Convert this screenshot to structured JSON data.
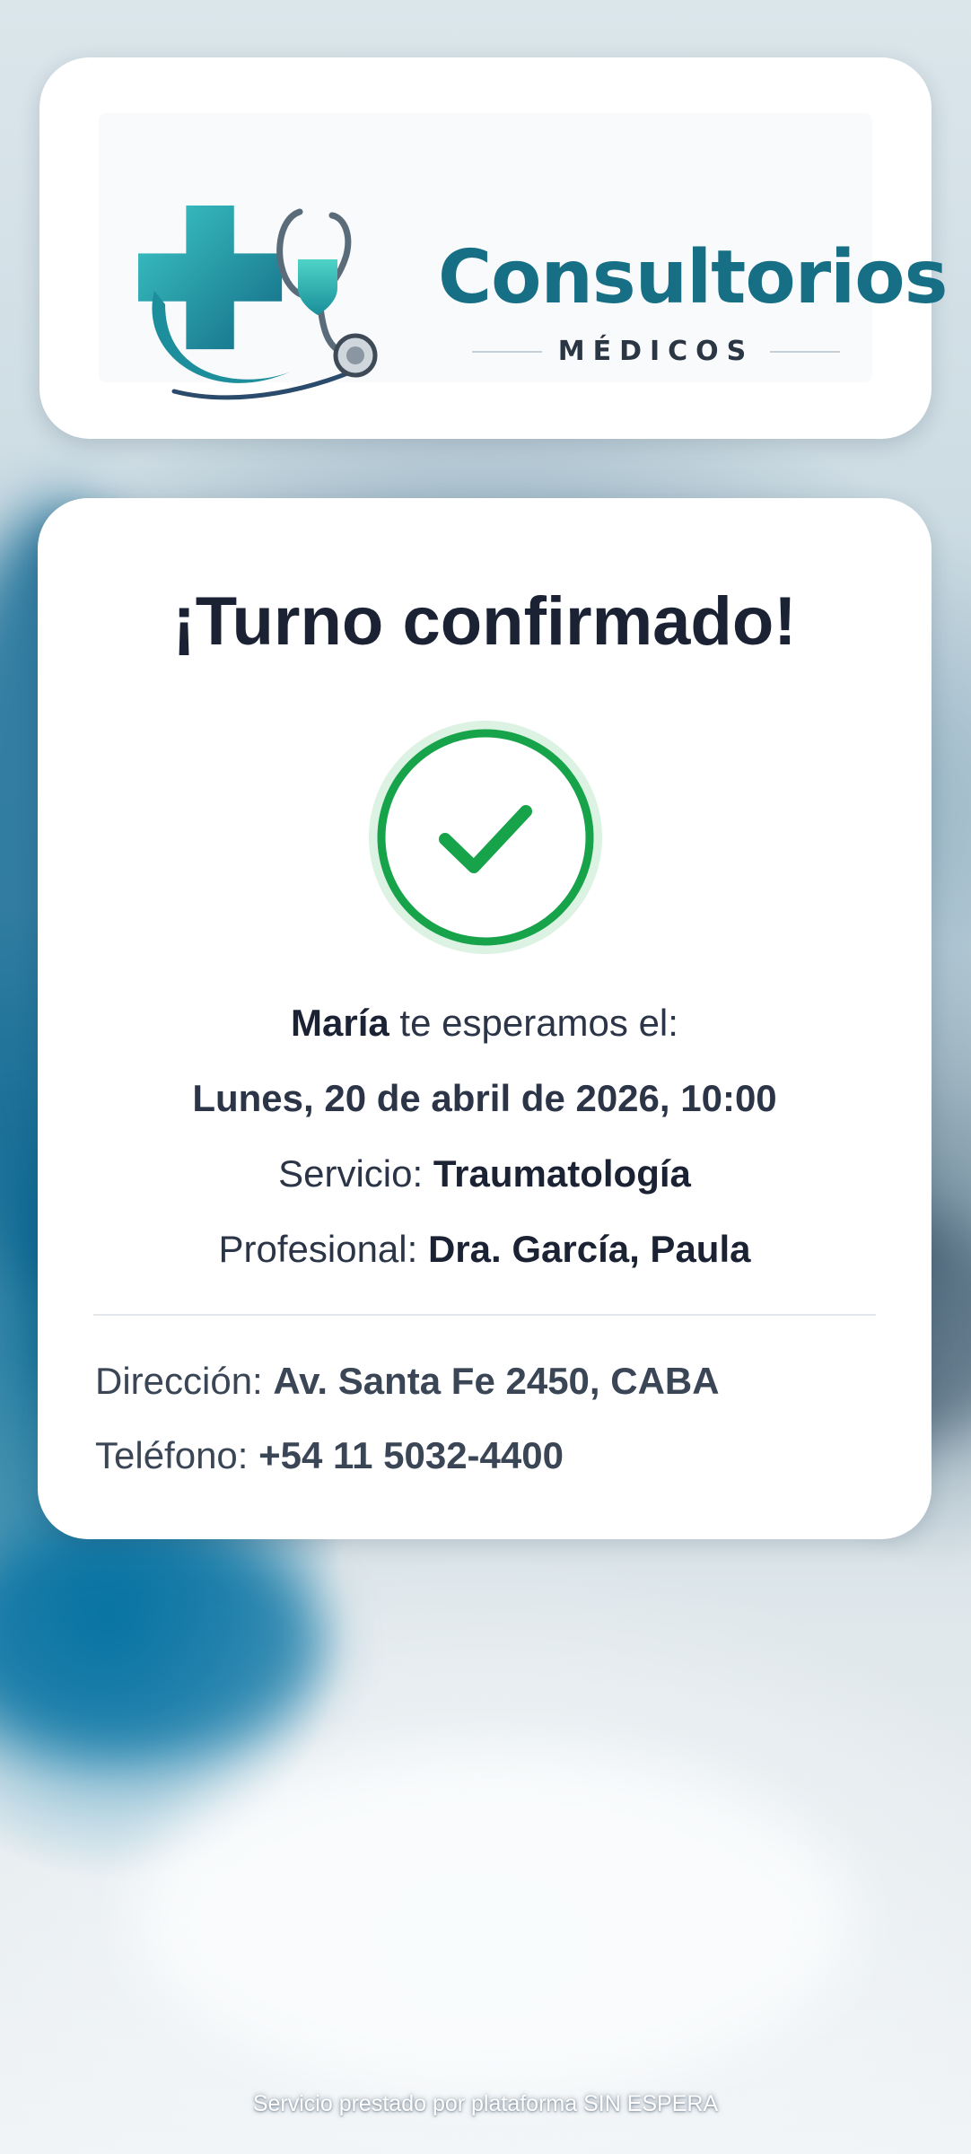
{
  "brand": {
    "name": "Consultorios",
    "subtitle": "MÉDICOS",
    "colors": {
      "teal": "#176f85",
      "teal_light": "#22b3b3",
      "navy": "#1b2234"
    }
  },
  "confirmation": {
    "title": "¡Turno confirmado!",
    "status_icon": "check-circle-icon",
    "status_color": "#16a34a",
    "patient_name": "María",
    "greeting_suffix": " te esperamos el:",
    "datetime": "Lunes, 20 de abril de 2026, 10:00",
    "service_label": "Servicio: ",
    "service_value": "Traumatología",
    "professional_label": "Profesional: ",
    "professional_value": "Dra. García, Paula"
  },
  "contact": {
    "address_label": "Dirección: ",
    "address_value": "Av. Santa Fe 2450, CABA",
    "phone_label": "Teléfono: ",
    "phone_value": "+54 11 5032-4400"
  },
  "footer": {
    "text": "Servicio prestado por plataforma SIN ESPERA"
  }
}
